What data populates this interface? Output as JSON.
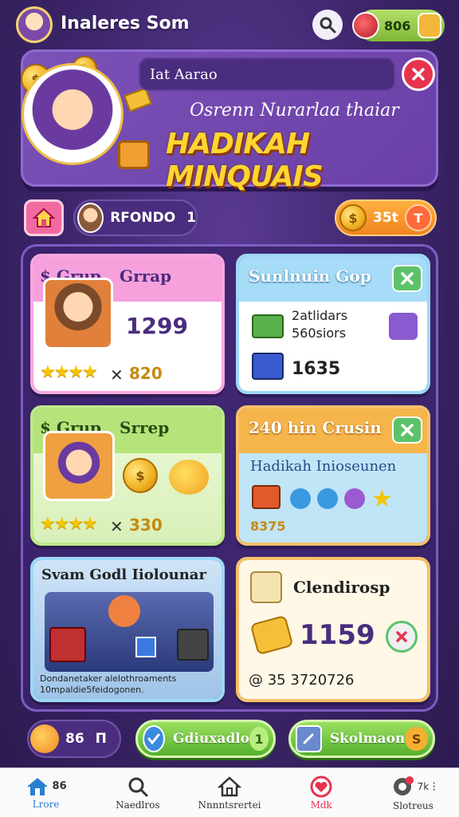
{
  "topbar": {
    "title": "Inaleres Som",
    "currency_value": "806"
  },
  "banner": {
    "input_value": "Iat Aarao",
    "subtitle": "Osrenn Nurarlaa thaiar",
    "title": "HADIKAH MINQUAIS"
  },
  "subheader": {
    "player_name": "RFONDO",
    "player_count": "1",
    "coins": "35t",
    "coin_button": "T"
  },
  "cards": [
    {
      "tag": "$ Grup",
      "title": "Grrap",
      "value": "1299",
      "stars": "★★★★",
      "mult": "✕",
      "amount": "820"
    },
    {
      "title": "Sunlnuin Gop",
      "line1": "2atlidars",
      "line2": "560siors",
      "value": "1635"
    },
    {
      "tag": "$ Grup",
      "title": "Srrep",
      "stars": "★★★★",
      "mult": "✕",
      "amount": "330"
    },
    {
      "title": "240 hin Crusin",
      "subtitle": "Hadikah Inioseunen",
      "amount": "8375"
    },
    {
      "title": "Svam Godl Iiolounar",
      "caption_line1": "Dondanetaker alelothroaments",
      "caption_line2": "10mpaldie5feidogonen."
    },
    {
      "title": "Clendirosp",
      "value": "1159",
      "footer": "@ 35 3720726"
    }
  ],
  "actions": {
    "level_value": "86",
    "level_mark": "Π",
    "button1_label": "Gdiuxadlo",
    "button1_badge": "1",
    "button2_label": "Skolmaon",
    "button2_badge": "S"
  },
  "nav": [
    {
      "label": "Lrore",
      "extra": "86"
    },
    {
      "label": "Naedlros"
    },
    {
      "label": "Nnnntsrertei"
    },
    {
      "label": "Mdk"
    },
    {
      "label": "Slotreus",
      "extra": "7k"
    }
  ],
  "colors": {
    "background": "#3b2468",
    "accent_gold": "#ffd530",
    "close_red": "#e8334f",
    "button_green": "#55b02e"
  }
}
